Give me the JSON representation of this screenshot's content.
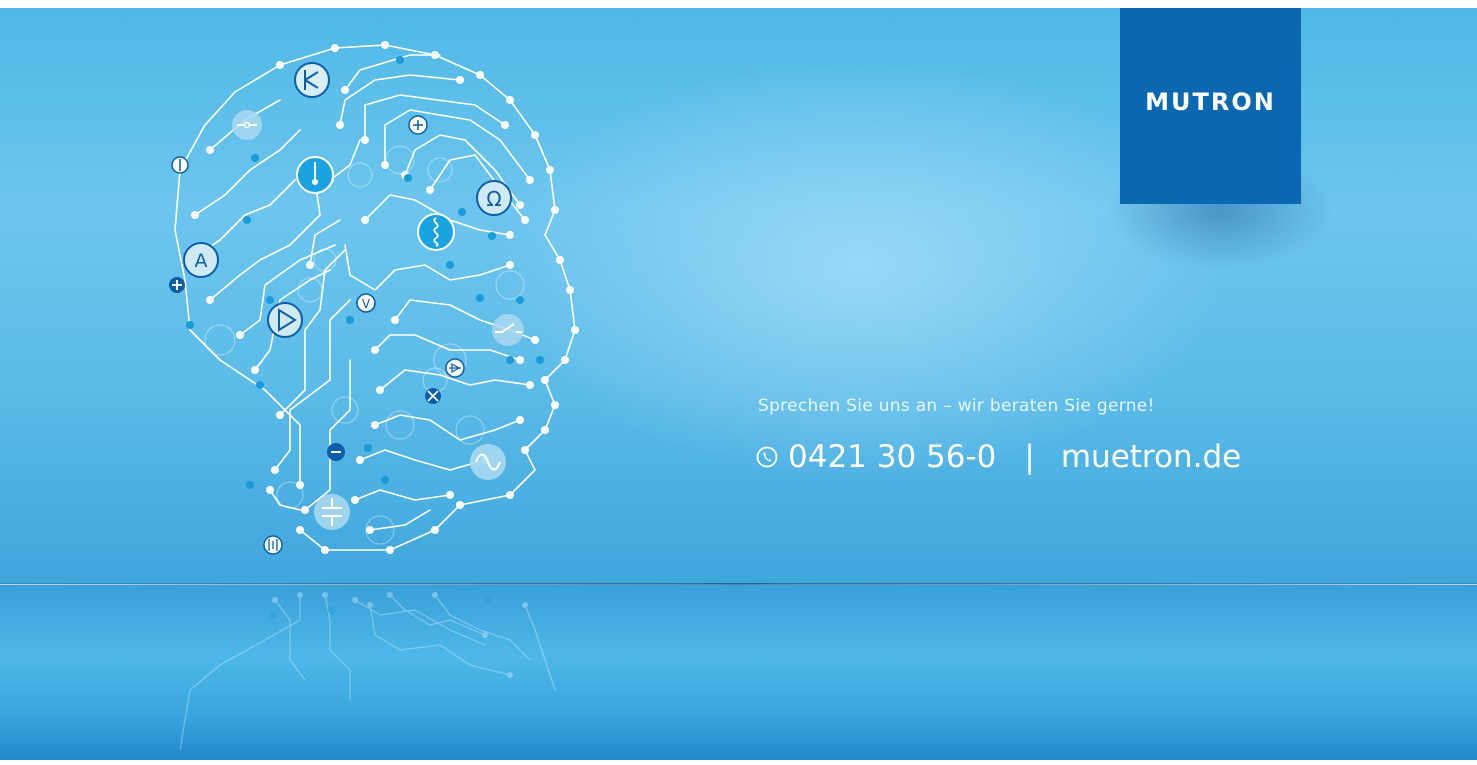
{
  "brand": {
    "logo_text": "MUTRON",
    "logo_color": "#0a67b0"
  },
  "contact": {
    "tagline": "Sprechen Sie uns an – wir beraten Sie gerne!",
    "phone": "0421 30 56-0",
    "separator": "|",
    "website": "muetron.de",
    "phone_icon": "phone-icon"
  },
  "illustration": {
    "subject": "circuit-board-head",
    "symbols": {
      "ammeter": "A",
      "ohm": "Ω",
      "voltmeter": "V",
      "plus": "+",
      "minus": "−"
    }
  },
  "colors": {
    "sky": "#5cbbe8",
    "floor": "#3aa0d8",
    "accent_dark": "#0a5da8"
  }
}
